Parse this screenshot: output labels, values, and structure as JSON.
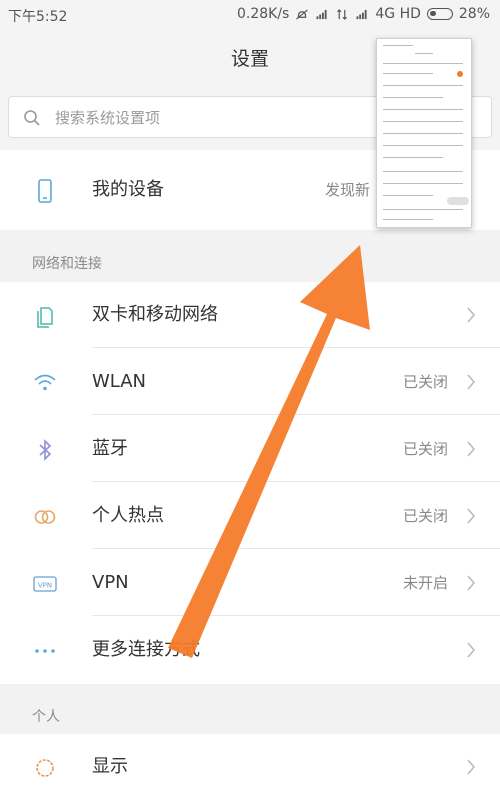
{
  "status_bar": {
    "time": "下午5:52",
    "net_speed": "0.28K/s",
    "network_type": "4G HD",
    "battery": "28%"
  },
  "header": {
    "title": "设置"
  },
  "search": {
    "placeholder": "搜索系统设置项"
  },
  "my_device": {
    "label": "我的设备",
    "value": "发现新"
  },
  "sections": {
    "network": {
      "title": "网络和连接",
      "items": [
        {
          "label": "双卡和移动网络",
          "value": "",
          "icon": "sim-card-icon"
        },
        {
          "label": "WLAN",
          "value": "已关闭",
          "icon": "wifi-icon"
        },
        {
          "label": "蓝牙",
          "value": "已关闭",
          "icon": "bluetooth-icon"
        },
        {
          "label": "个人热点",
          "value": "已关闭",
          "icon": "hotspot-icon"
        },
        {
          "label": "VPN",
          "value": "未开启",
          "icon": "vpn-icon"
        },
        {
          "label": "更多连接方式",
          "value": "",
          "icon": "more-dots-icon"
        }
      ]
    },
    "personal": {
      "title": "个人",
      "items": [
        {
          "label": "显示",
          "value": "",
          "icon": "display-brightness-icon"
        }
      ]
    }
  },
  "colors": {
    "wifi": "#5aa9d8",
    "bluetooth": "#8f8fd6",
    "hotspot": "#e8a86a",
    "display": "#e8974a",
    "arrow": "#f47b2a"
  }
}
